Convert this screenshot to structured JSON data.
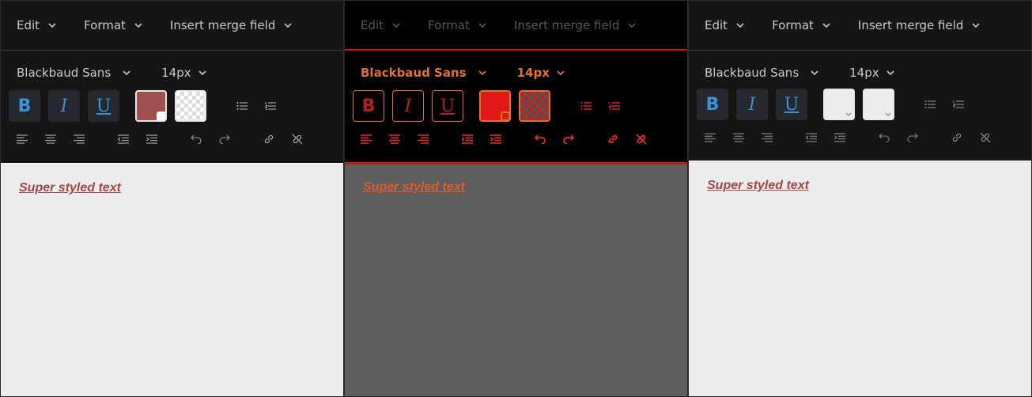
{
  "panels": [
    {
      "menus": [
        "Edit",
        "Format",
        "Insert merge field"
      ],
      "font": "Blackbaud Sans",
      "size": "14px",
      "format": {
        "bold": "B",
        "italic": "I",
        "underline": "U"
      },
      "text": "Super styled text"
    },
    {
      "menus": [
        "Edit",
        "Format",
        "Insert merge field"
      ],
      "font": "Blackbaud Sans",
      "size": "14px",
      "format": {
        "bold": "B",
        "italic": "I",
        "underline": "U"
      },
      "text": "Super styled text"
    },
    {
      "menus": [
        "Edit",
        "Format",
        "Insert merge field"
      ],
      "font": "Blackbaud Sans",
      "size": "14px",
      "format": {
        "bold": "B",
        "italic": "I",
        "underline": "U"
      },
      "text": "Super styled text"
    }
  ],
  "colors": {
    "text_color": "#a05050",
    "accent": "#3d8fd6",
    "contrast_accent": "#c01818",
    "contrast_orange": "#e0702a"
  },
  "icons": [
    "chevron-down-icon",
    "bullet-list-icon",
    "numbered-list-icon",
    "align-left-icon",
    "align-center-icon",
    "align-right-icon",
    "outdent-icon",
    "indent-icon",
    "undo-icon",
    "redo-icon",
    "link-icon",
    "unlink-icon"
  ]
}
